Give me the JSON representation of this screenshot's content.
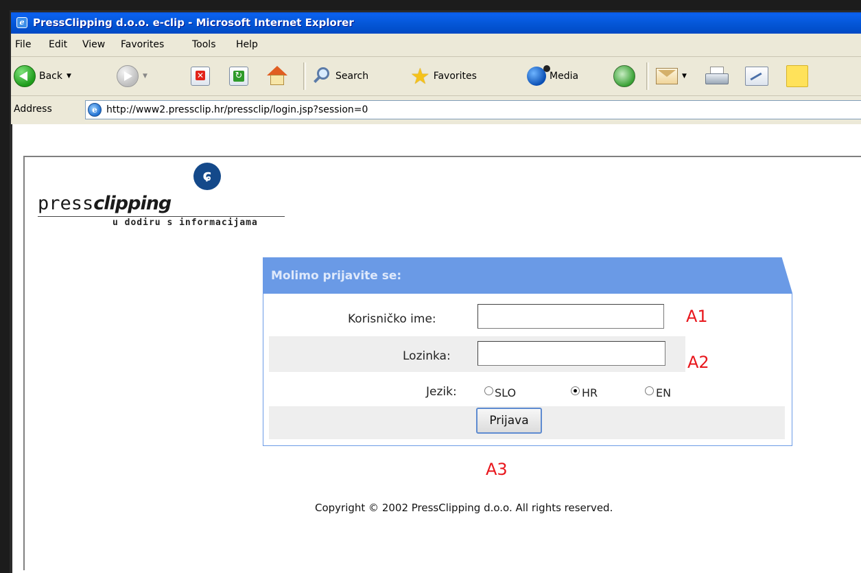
{
  "window": {
    "title": "PressClipping d.o.o. e-clip - Microsoft Internet Explorer"
  },
  "menu": [
    "File",
    "Edit",
    "View",
    "Favorites",
    "Tools",
    "Help"
  ],
  "toolbar": {
    "back_label": "Back",
    "search_label": "Search",
    "favorites_label": "Favorites",
    "media_label": "Media"
  },
  "address": {
    "label": "Address",
    "url": "http://www2.pressclip.hr/pressclip/login.jsp?session=0"
  },
  "logo": {
    "text_plain": "press",
    "text_bold": "clipping",
    "tagline": "u dodiru s informacijama"
  },
  "login": {
    "heading": "Molimo prijavite se:",
    "username_label": "Korisničko ime:",
    "username_value": "",
    "password_label": "Lozinka:",
    "password_value": "",
    "language_label": "Jezik:",
    "languages": [
      {
        "label": "SLO",
        "selected": false
      },
      {
        "label": "HR",
        "selected": true
      },
      {
        "label": "EN",
        "selected": false
      }
    ],
    "submit_label": "Prijava"
  },
  "annotations": {
    "a1": "A1",
    "a2": "A2",
    "a3": "A3"
  },
  "footer": {
    "copyright": "Copyright © 2002 PressClipping d.o.o. All rights reserved."
  }
}
